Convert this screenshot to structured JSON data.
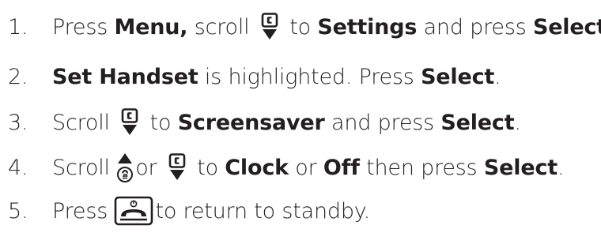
{
  "steps": [
    {
      "number": "1.",
      "parts": {
        "t1": "Press ",
        "b1": "Menu,",
        "t2": " scroll ",
        "t3": " to ",
        "b2": "Settings",
        "t4": " and press ",
        "b3": "Select",
        "t5": "."
      },
      "icons": [
        "scroll-down-icon"
      ]
    },
    {
      "number": "2.",
      "parts": {
        "b1": "Set Handset",
        "t1": " is highlighted. Press ",
        "b2": "Select",
        "t2": "."
      }
    },
    {
      "number": "3.",
      "parts": {
        "t1": "Scroll ",
        "t2": " to ",
        "b1": "Screensaver",
        "t3": " and press ",
        "b2": "Select",
        "t4": "."
      },
      "icons": [
        "scroll-down-icon"
      ]
    },
    {
      "number": "4.",
      "parts": {
        "t1": "Scroll ",
        "t2": "or ",
        "t3": " to ",
        "b1": "Clock",
        "t4": " or ",
        "b2": "Off",
        "t5": " then press ",
        "b3": "Select",
        "t6": "."
      },
      "icons": [
        "scroll-up-icon",
        "scroll-down-icon"
      ]
    },
    {
      "number": "5.",
      "parts": {
        "t1": "Press ",
        "t2": "to return to standby."
      },
      "icons": [
        "end-call-key-icon"
      ]
    }
  ],
  "colors": {
    "text": "#231f20",
    "background": "#ffffff"
  }
}
